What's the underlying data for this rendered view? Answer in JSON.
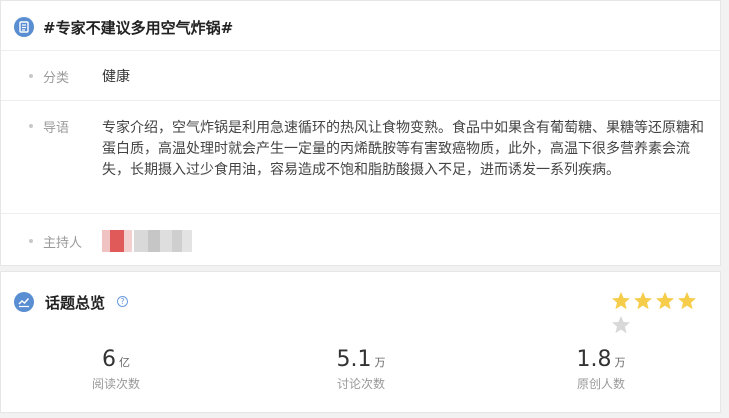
{
  "topic": {
    "title": "#专家不建议多用空气炸锅#",
    "category_label": "分类",
    "category_value": "健康",
    "lead_label": "导语",
    "lead_text": "专家介绍，空气炸锅是利用急速循环的热风让食物变熟。食品中如果含有葡萄糖、果糖等还原糖和蛋白质，高温处理时就会产生一定量的丙烯酰胺等有害致癌物质，此外，高温下很多营养素会流失，长期摄入过少食用油，容易造成不饱和脂肪酸摄入不足，进而诱发一系列疾病。",
    "host_label": "主持人"
  },
  "overview": {
    "title": "话题总览",
    "help_glyph": "?",
    "rating": 4,
    "rating_max": 5,
    "star_color": "#f5cd4b",
    "star_empty_color": "#d8d8d8",
    "stats": [
      {
        "num": "6",
        "unit": "亿",
        "label": "阅读次数"
      },
      {
        "num": "5.1",
        "unit": "万",
        "label": "讨论次数"
      },
      {
        "num": "1.8",
        "unit": "万",
        "label": "原创人数"
      }
    ]
  },
  "accent_color": "#5a8ed2"
}
